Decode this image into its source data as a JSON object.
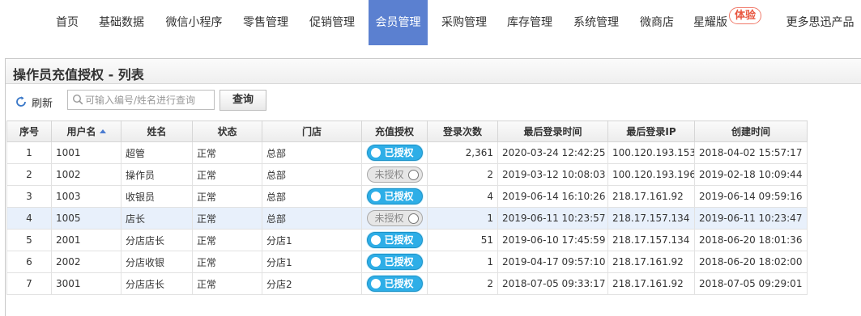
{
  "nav": {
    "items": [
      {
        "label": "首页",
        "active": false
      },
      {
        "label": "基础数据",
        "active": false
      },
      {
        "label": "微信小程序",
        "active": false
      },
      {
        "label": "零售管理",
        "active": false
      },
      {
        "label": "促销管理",
        "active": false
      },
      {
        "label": "会员管理",
        "active": true
      },
      {
        "label": "采购管理",
        "active": false
      },
      {
        "label": "库存管理",
        "active": false
      },
      {
        "label": "系统管理",
        "active": false
      },
      {
        "label": "微商店",
        "active": false
      },
      {
        "label": "星耀版",
        "active": false
      },
      {
        "label": "更多思迅产品",
        "active": false
      }
    ],
    "trial_badge": "体验",
    "active_color": "#5b80d0"
  },
  "panel": {
    "title": "操作员充值授权 - 列表"
  },
  "toolbar": {
    "refresh_label": "刷新",
    "refresh_icon": "refresh-icon",
    "search_placeholder": "可输入编号/姓名进行查询",
    "search_value": "",
    "search_icon": "search-icon",
    "query_label": "查询"
  },
  "table": {
    "columns": [
      "序号",
      "用户名",
      "姓名",
      "状态",
      "门店",
      "充值授权",
      "登录次数",
      "最后登录时间",
      "最后登录IP",
      "创建时间"
    ],
    "sorted_column": "用户名",
    "sort_direction": "asc",
    "authorized_label": "已授权",
    "unauthorized_label": "未授权",
    "rows": [
      {
        "no": "1",
        "username": "1001",
        "name": "超管",
        "status": "正常",
        "store": "总部",
        "authorized": true,
        "logins": "2,361",
        "last_login": "2020-03-24 12:42:25",
        "last_ip": "100.120.193.153",
        "created": "2018-04-02 15:57:17"
      },
      {
        "no": "2",
        "username": "1002",
        "name": "操作员",
        "status": "正常",
        "store": "总部",
        "authorized": false,
        "logins": "2",
        "last_login": "2019-03-12 10:08:03",
        "last_ip": "100.120.193.196",
        "created": "2019-02-18 10:09:44"
      },
      {
        "no": "3",
        "username": "1003",
        "name": "收银员",
        "status": "正常",
        "store": "总部",
        "authorized": true,
        "logins": "4",
        "last_login": "2019-06-14 16:10:26",
        "last_ip": "218.17.161.92",
        "created": "2019-06-14 09:59:16"
      },
      {
        "no": "4",
        "username": "1005",
        "name": "店长",
        "status": "正常",
        "store": "总部",
        "authorized": false,
        "logins": "1",
        "last_login": "2019-06-11 10:23:57",
        "last_ip": "218.17.157.134",
        "created": "2019-06-11 10:23:47",
        "highlighted": true
      },
      {
        "no": "5",
        "username": "2001",
        "name": "分店店长",
        "status": "正常",
        "store": "分店1",
        "authorized": true,
        "logins": "51",
        "last_login": "2019-06-10 17:45:59",
        "last_ip": "218.17.157.134",
        "created": "2018-06-20 18:01:36"
      },
      {
        "no": "6",
        "username": "2002",
        "name": "分店收银",
        "status": "正常",
        "store": "分店1",
        "authorized": true,
        "logins": "1",
        "last_login": "2019-04-17 09:57:10",
        "last_ip": "218.17.161.92",
        "created": "2018-06-20 18:02:00"
      },
      {
        "no": "7",
        "username": "3001",
        "name": "分店店长",
        "status": "正常",
        "store": "分店2",
        "authorized": true,
        "logins": "2",
        "last_login": "2018-07-05 09:33:17",
        "last_ip": "218.17.161.92",
        "created": "2018-07-05 09:29:01"
      }
    ]
  }
}
